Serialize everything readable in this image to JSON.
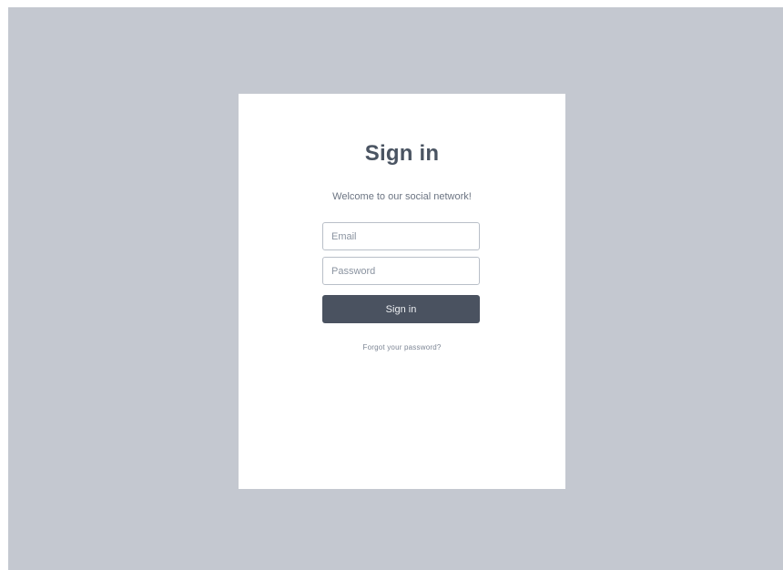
{
  "signin": {
    "title": "Sign in",
    "subtitle": "Welcome to our social network!",
    "email_placeholder": "Email",
    "email_value": "",
    "password_placeholder": "Password",
    "password_value": "",
    "submit_label": "Sign in",
    "forgot_label": "Forgot your password?"
  },
  "colors": {
    "background": "#c4c8d0",
    "card": "#ffffff",
    "button": "#4a5260",
    "title_text": "#4a5462"
  }
}
